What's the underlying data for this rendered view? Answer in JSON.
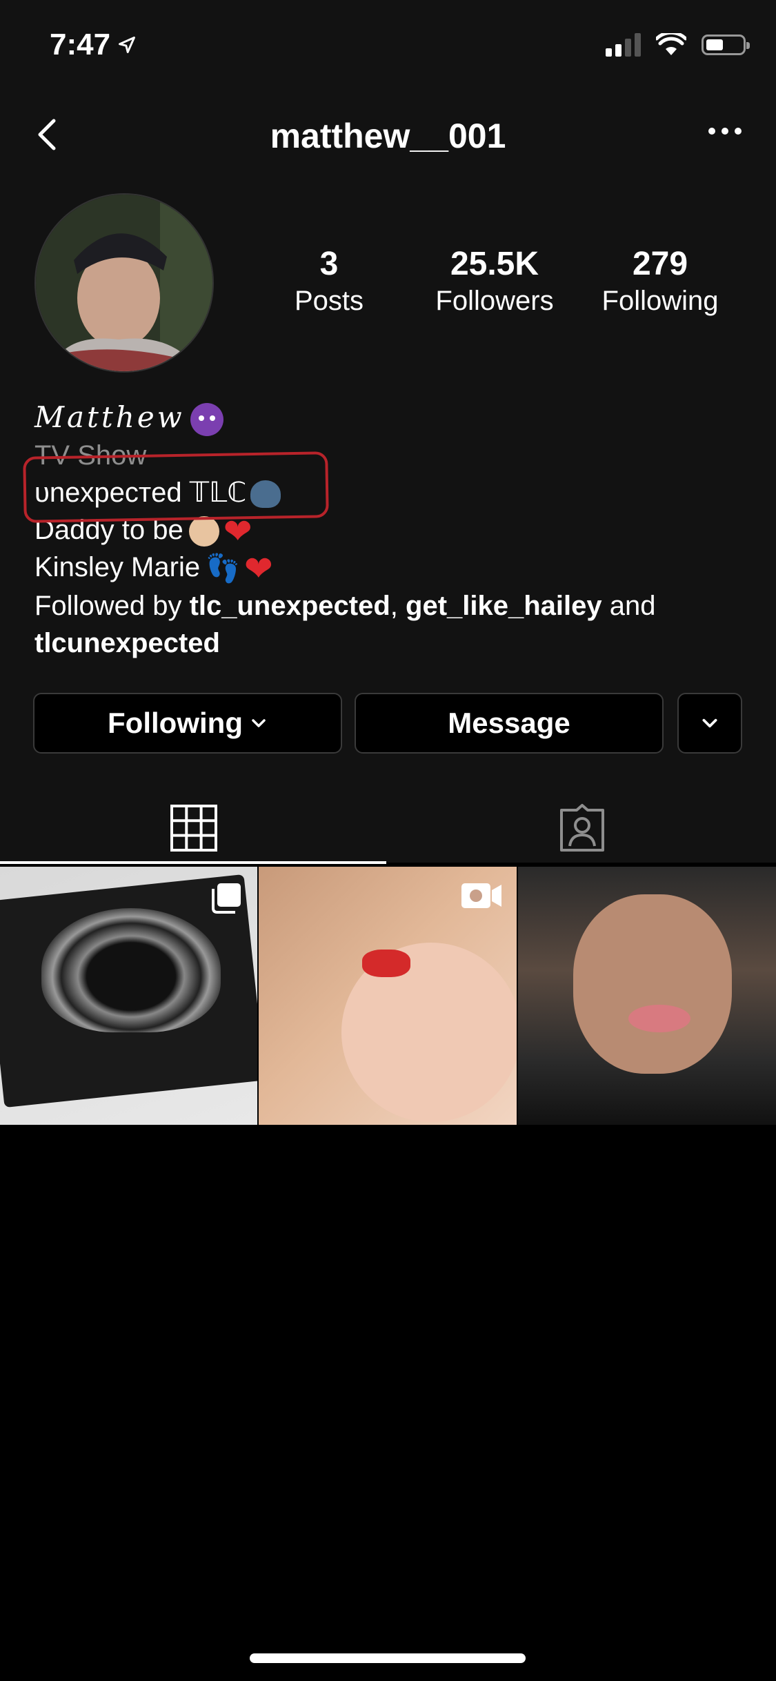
{
  "status_bar": {
    "time": "7:47"
  },
  "header": {
    "username": "matthew__001"
  },
  "stats": [
    {
      "value": "3",
      "label": "Posts"
    },
    {
      "value": "25.5K",
      "label": "Followers"
    },
    {
      "value": "279",
      "label": "Following"
    }
  ],
  "bio": {
    "name": "𝑀𝑎𝑡𝑡ℎ𝑒𝑤",
    "category": "TV Show",
    "line1": "ᴜnexpecтed 𝕋𝕃ℂ",
    "line2": "Daddy to be",
    "line3": "Kinsley Marie",
    "followed_by_prefix": "Followed by",
    "followed_user_1": "tlc_unexpected",
    "followed_sep": ",",
    "followed_user_2": "get_like_hailey",
    "followed_and": "and",
    "followed_user_3": "tlcunexpected"
  },
  "actions": {
    "following_label": "Following",
    "message_label": "Message"
  },
  "tabs": [
    {
      "name": "grid-icon",
      "active": true
    },
    {
      "name": "tagged-icon",
      "active": false
    }
  ],
  "posts": [
    {
      "type": "multi",
      "overlay_icon": "carousel-icon"
    },
    {
      "type": "video",
      "overlay_icon": "video-icon"
    },
    {
      "type": "photo",
      "overlay_icon": ""
    }
  ],
  "colors": {
    "background": "#121212",
    "highlight": "#b8232a",
    "muted": "#8e8e8e"
  }
}
